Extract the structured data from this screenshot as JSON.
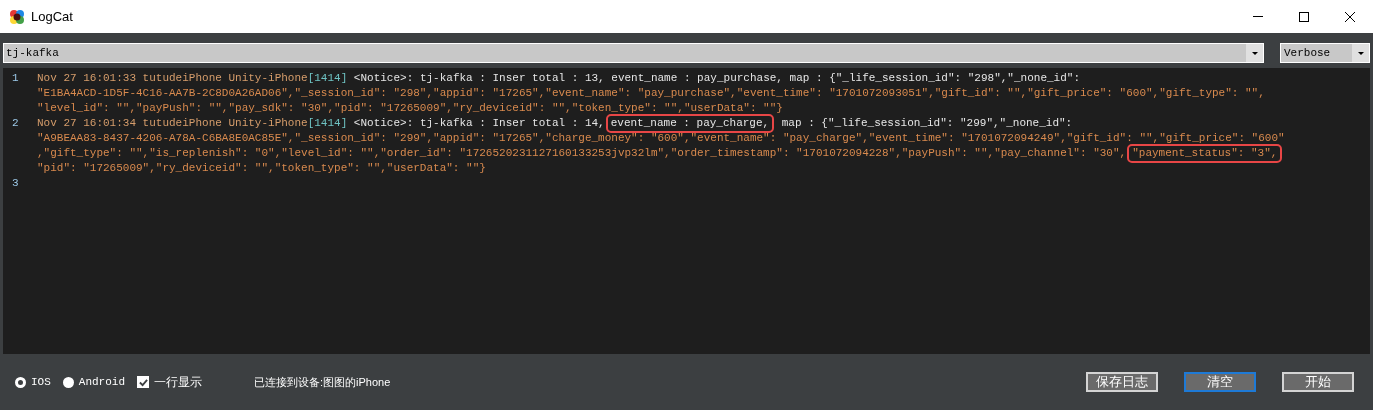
{
  "window": {
    "title": "LogCat"
  },
  "filter": {
    "value": "tj-kafka"
  },
  "level_select": {
    "value": "Verbose"
  },
  "log": [
    {
      "number": "1",
      "rows": [
        {
          "parts": [
            {
              "kind": "header",
              "text": "Nov 27 16:01:33 tutudeiPhone Unity-iPhone",
              "boxed": false
            },
            {
              "kind": "pid",
              "text": "[1414]",
              "boxed": false
            },
            {
              "kind": "text",
              "text": " <Notice>: tj-kafka : Inser total : 13, event_name : pay_purchase, map : {\"_life_session_id\": \"298\",\"_none_id\":",
              "boxed": false
            }
          ]
        },
        {
          "parts": [
            {
              "kind": "json",
              "text": "\"E1BA4ACD-1D5F-4C16-AA7B-2C8D0A26AD06\",\"_session_id\": \"298\",\"appid\": \"17265\",\"event_name\": \"pay_purchase\",\"event_time\": \"1701072093051\",\"gift_id\": \"\",\"gift_price\": \"600\",\"gift_type\": \"\",",
              "boxed": false
            }
          ]
        },
        {
          "parts": [
            {
              "kind": "json",
              "text": "\"level_id\": \"\",\"payPush\": \"\",\"pay_sdk\": \"30\",\"pid\": \"17265009\",\"ry_deviceid\": \"\",\"token_type\": \"\",\"userData\": \"\"}",
              "boxed": false
            }
          ]
        }
      ]
    },
    {
      "number": "2",
      "rows": [
        {
          "parts": [
            {
              "kind": "header",
              "text": "Nov 27 16:01:34 tutudeiPhone Unity-iPhone",
              "boxed": false
            },
            {
              "kind": "pid",
              "text": "[1414]",
              "boxed": false
            },
            {
              "kind": "text",
              "text": " <Notice>: tj-kafka : Inser total : 14,",
              "boxed": false
            },
            {
              "kind": "text",
              "text": "event_name : pay_charge,",
              "boxed": true
            },
            {
              "kind": "text",
              "text": " map : {\"_life_session_id\": \"299\",\"_none_id\":",
              "boxed": false
            }
          ]
        },
        {
          "parts": [
            {
              "kind": "json",
              "text": "\"A9BEAA83-8437-4206-A78A-C6BA8E0AC85E\",\"_session_id\": \"299\",\"appid\": \"17265\",\"charge_money\": \"600\",\"event_name\": \"pay_charge\",\"event_time\": \"1701072094249\",\"gift_id\": \"\",\"gift_price\": \"600\"",
              "boxed": false
            }
          ]
        },
        {
          "parts": [
            {
              "kind": "json",
              "text": ",\"gift_type\": \"\",\"is_replenish\": \"0\",\"level_id\": \"\",\"order_id\": \"1726520231127160133253jvp32lm\",\"order_timestamp\": \"1701072094228\",\"payPush\": \"\",\"pay_channel\": \"30\",",
              "boxed": false
            },
            {
              "kind": "json",
              "text": "\"payment_status\": \"3\",",
              "boxed": true
            }
          ]
        },
        {
          "parts": [
            {
              "kind": "json",
              "text": "\"pid\": \"17265009\",\"ry_deviceid\": \"\",\"token_type\": \"\",\"userData\": \"\"}",
              "boxed": false
            }
          ]
        }
      ]
    },
    {
      "number": "3"
    }
  ],
  "platforms": [
    {
      "label": "IOS",
      "selected": true
    },
    {
      "label": "Android",
      "selected": false
    }
  ],
  "single_line": {
    "label": "一行显示",
    "checked": true
  },
  "status": "已连接到设备:图图的iPhone",
  "buttons": [
    {
      "label": "保存日志",
      "focused": false
    },
    {
      "label": "清空",
      "focused": true
    },
    {
      "label": "开始",
      "focused": false
    }
  ]
}
